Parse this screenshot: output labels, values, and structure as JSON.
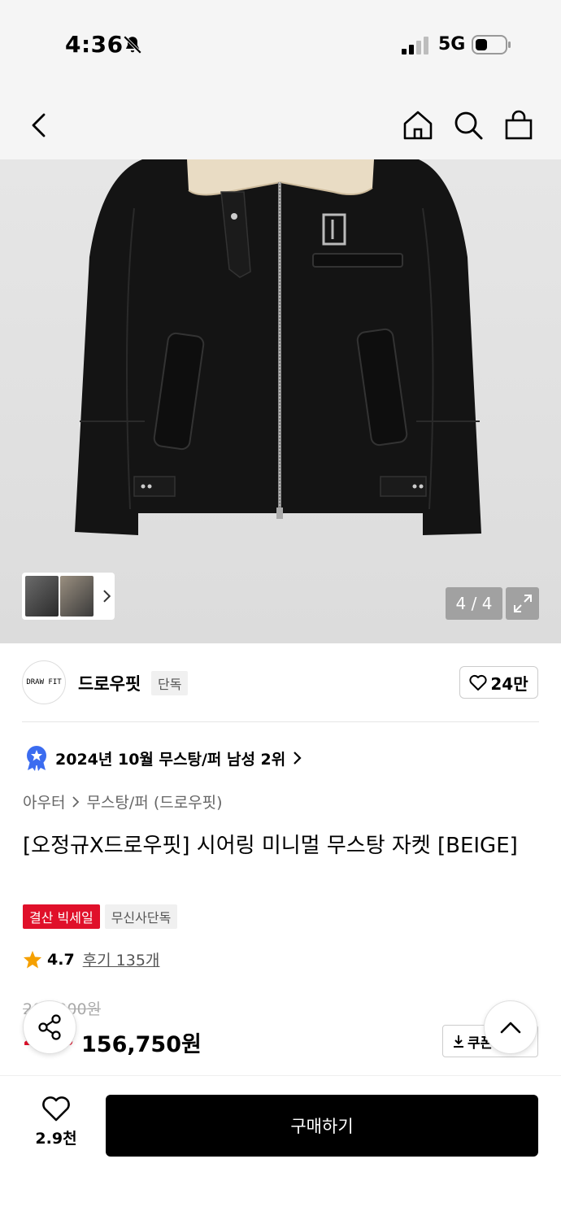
{
  "status_bar": {
    "time": "4:36",
    "network": "5G",
    "icons": [
      "bell-off-icon",
      "signal-icon",
      "battery-icon"
    ]
  },
  "nav": {
    "icons": [
      "back-icon",
      "home-icon",
      "search-icon",
      "bag-icon"
    ]
  },
  "gallery": {
    "counter": "4 / 4",
    "icons": [
      "chevron-right-icon",
      "expand-icon"
    ]
  },
  "brand": {
    "logo_text": "DRAW FIT",
    "name": "드로우핏",
    "badge": "단독",
    "likes": "24만"
  },
  "ranking": {
    "text": "2024년 10월 무스탕/퍼 남성 2위"
  },
  "category": {
    "level1": "아우터",
    "level2": "무스탕/퍼 (드로우핏)"
  },
  "product": {
    "title": "[오정규X드로우핏] 시어링 미니멀 무스탕 자켓 [BEIGE]",
    "tags": [
      "결산 빅세일",
      "무신사단독"
    ],
    "rating": "4.7",
    "review_label": "후기 135개",
    "original_price": "209,000원",
    "discount": "25%",
    "price": "156,750원",
    "coupon_label": "쿠폰"
  },
  "bottom": {
    "wish_count": "2.9천",
    "buy_label": "구매하기"
  }
}
